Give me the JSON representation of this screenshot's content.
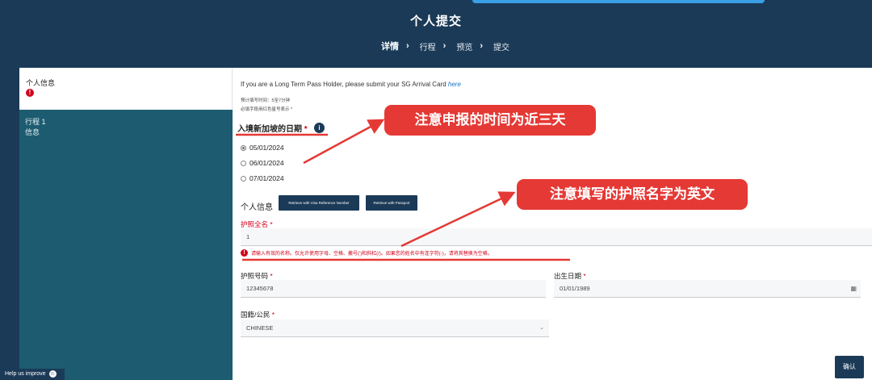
{
  "header": {
    "title": "个人提交",
    "steps": [
      "详情",
      "行程",
      "预览",
      "提交"
    ]
  },
  "sidebar": {
    "personal_info": "个人信息",
    "error_mark": "!",
    "trip_line1": "行程 1",
    "trip_line2": "信息",
    "help": "Help us improve"
  },
  "main": {
    "notice_text": "If you are a Long Term Pass Holder, please submit your SG Arrival Card",
    "notice_link": "here",
    "hint_time": "预计填写时间：5至7分钟",
    "hint_required": "必填字段用红色星号表示 *",
    "arrival_label": "入境新加坡的日期",
    "required_mark": "*",
    "info_icon": "i",
    "dates": [
      {
        "label": "05/01/2024",
        "checked": true
      },
      {
        "label": "06/01/2024",
        "checked": false
      },
      {
        "label": "07/01/2024",
        "checked": false
      }
    ],
    "personal_section": "个人信息",
    "btn_visa_ref": "Retrieve with Visa Reference Number",
    "btn_passport": "Retrieve with Passport",
    "passport_name_label": "护照全名",
    "passport_name_value": "1",
    "name_error": "请输入有效的名称。仅允许使用字母、空格、撇号(')和斜杠(/)。如果您的姓名中有连字符(-)，请将其替换为空格。",
    "passport_no_label": "护照号码",
    "passport_no_value": "12345678",
    "dob_label": "出生日期",
    "dob_value": "01/01/1989",
    "nationality_label": "国籍/公民",
    "nationality_value": "CHINESE",
    "confirm": "确认"
  },
  "annotations": {
    "note1": "注意申报的时间为近三天",
    "note2": "注意填写的护照名字为英文",
    "color": "#e53935"
  },
  "colors": {
    "navy": "#1b3a57",
    "teal": "#1d5c70",
    "error_red": "#d0021b"
  }
}
